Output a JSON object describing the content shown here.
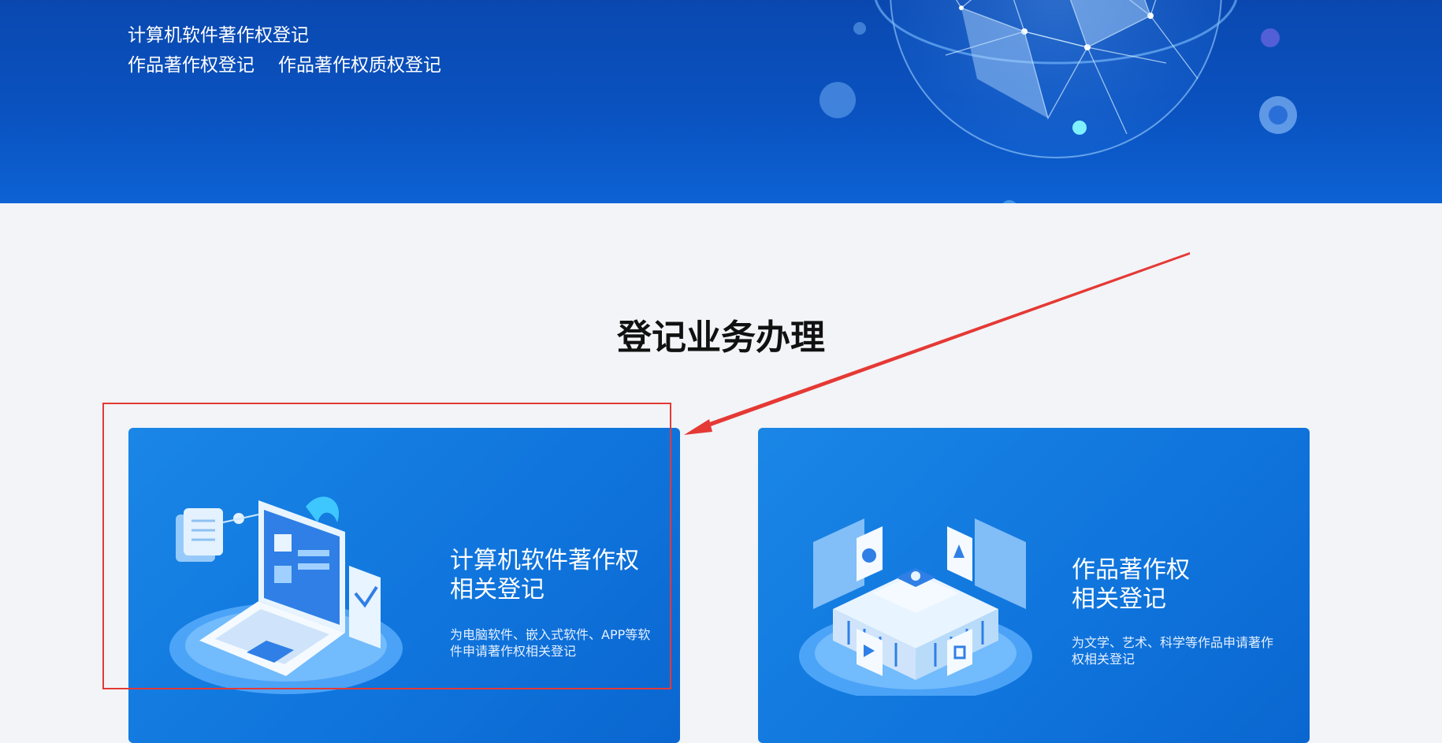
{
  "banner": {
    "links": [
      "计算机软件著作权登记",
      "作品著作权登记",
      "作品著作权质权登记"
    ]
  },
  "section": {
    "title": "登记业务办理"
  },
  "cards": [
    {
      "title_line1": "计算机软件著作权",
      "title_line2": "相关登记",
      "desc": "为电脑软件、嵌入式软件、APP等软件申请著作权相关登记"
    },
    {
      "title_line1": "作品著作权",
      "title_line2": "相关登记",
      "desc": "为文学、艺术、科学等作品申请著作权相关登记"
    }
  ],
  "colors": {
    "banner": "#0a48b0",
    "card": "#1a86e6",
    "annotation": "#e53935"
  }
}
